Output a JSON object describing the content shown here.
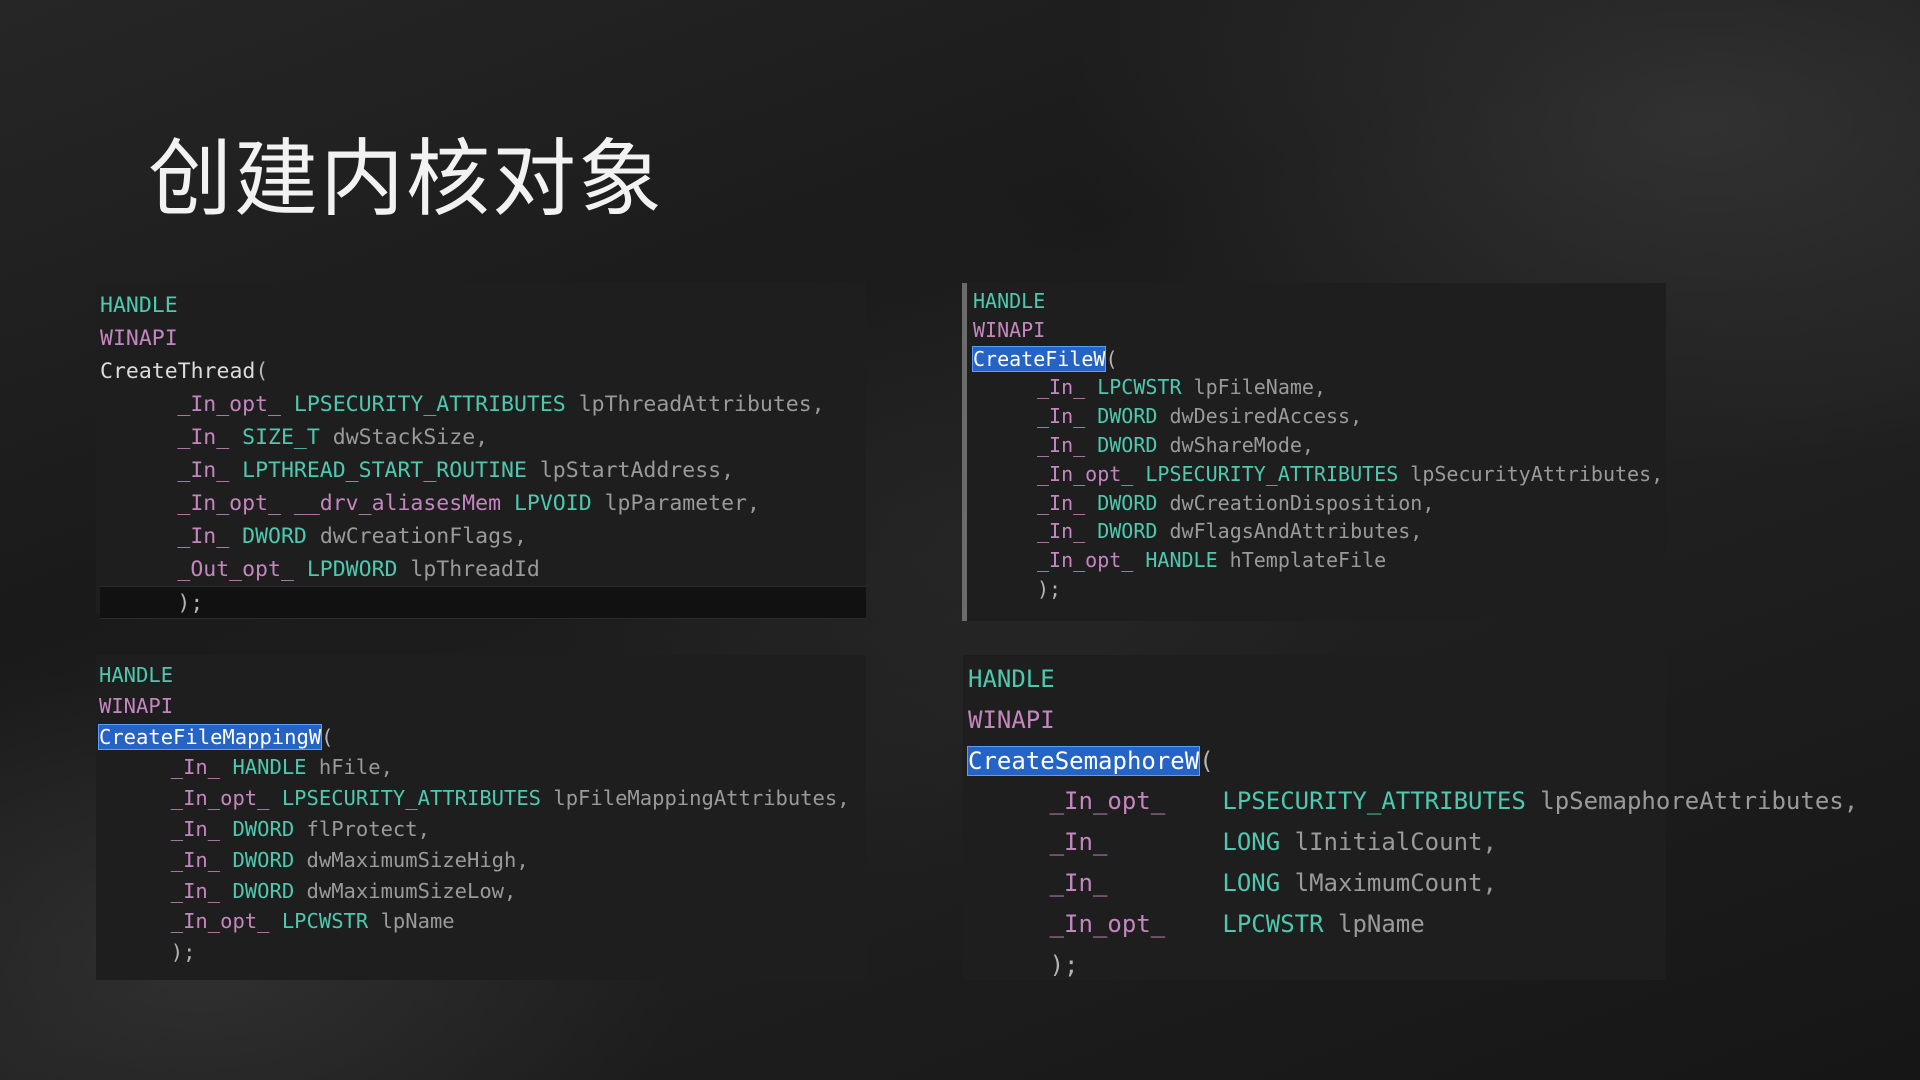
{
  "slide": {
    "title": "创建内核对象"
  },
  "panels": [
    {
      "id": "create-thread",
      "lines": [
        [
          {
            "t": "kw",
            "s": "HANDLE"
          }
        ],
        [
          {
            "t": "call",
            "s": "WINAPI"
          }
        ],
        [
          {
            "t": "func",
            "s": "CreateThread"
          },
          {
            "t": "punc",
            "s": "("
          }
        ],
        [
          {
            "t": "sal",
            "s": "_In_opt_"
          },
          {
            "t": "type",
            "s": "LPSECURITY_ATTRIBUTES"
          },
          {
            "t": "name",
            "s": "lpThreadAttributes,"
          }
        ],
        [
          {
            "t": "sal",
            "s": "_In_"
          },
          {
            "t": "type",
            "s": "SIZE_T"
          },
          {
            "t": "name",
            "s": "dwStackSize,"
          }
        ],
        [
          {
            "t": "sal",
            "s": "_In_"
          },
          {
            "t": "type",
            "s": "LPTHREAD_START_ROUTINE"
          },
          {
            "t": "name",
            "s": "lpStartAddress,"
          }
        ],
        [
          {
            "t": "sal",
            "s": "_In_opt_"
          },
          {
            "t": "sal",
            "s": "__drv_aliasesMem"
          },
          {
            "t": "type",
            "s": "LPVOID"
          },
          {
            "t": "name",
            "s": "lpParameter,"
          }
        ],
        [
          {
            "t": "sal",
            "s": "_In_"
          },
          {
            "t": "type",
            "s": "DWORD"
          },
          {
            "t": "name",
            "s": "dwCreationFlags,"
          }
        ],
        [
          {
            "t": "sal",
            "s": "_Out_opt_"
          },
          {
            "t": "type",
            "s": "LPDWORD"
          },
          {
            "t": "name",
            "s": "lpThreadId"
          }
        ],
        [
          {
            "t": "punc",
            "s": ");"
          }
        ]
      ]
    },
    {
      "id": "create-file",
      "lines": [
        [
          {
            "t": "kw",
            "s": "HANDLE"
          }
        ],
        [
          {
            "t": "call",
            "s": "WINAPI"
          }
        ],
        [
          {
            "t": "sel",
            "s": "CreateFileW"
          },
          {
            "t": "punc",
            "s": "("
          }
        ],
        [
          {
            "t": "sal",
            "s": "_In_"
          },
          {
            "t": "type",
            "s": "LPCWSTR"
          },
          {
            "t": "name",
            "s": "lpFileName,"
          }
        ],
        [
          {
            "t": "sal",
            "s": "_In_"
          },
          {
            "t": "type",
            "s": "DWORD"
          },
          {
            "t": "name",
            "s": "dwDesiredAccess,"
          }
        ],
        [
          {
            "t": "sal",
            "s": "_In_"
          },
          {
            "t": "type",
            "s": "DWORD"
          },
          {
            "t": "name",
            "s": "dwShareMode,"
          }
        ],
        [
          {
            "t": "sal",
            "s": "_In_opt_"
          },
          {
            "t": "type",
            "s": "LPSECURITY_ATTRIBUTES"
          },
          {
            "t": "name",
            "s": "lpSecurityAttributes,"
          }
        ],
        [
          {
            "t": "sal",
            "s": "_In_"
          },
          {
            "t": "type",
            "s": "DWORD"
          },
          {
            "t": "name",
            "s": "dwCreationDisposition,"
          }
        ],
        [
          {
            "t": "sal",
            "s": "_In_"
          },
          {
            "t": "type",
            "s": "DWORD"
          },
          {
            "t": "name",
            "s": "dwFlagsAndAttributes,"
          }
        ],
        [
          {
            "t": "sal",
            "s": "_In_opt_"
          },
          {
            "t": "type",
            "s": "HANDLE"
          },
          {
            "t": "name",
            "s": "hTemplateFile"
          }
        ],
        [
          {
            "t": "punc",
            "s": ");"
          }
        ]
      ]
    },
    {
      "id": "create-file-mapping",
      "lines": [
        [
          {
            "t": "kw",
            "s": "HANDLE"
          }
        ],
        [
          {
            "t": "call",
            "s": "WINAPI"
          }
        ],
        [
          {
            "t": "sel",
            "s": "CreateFileMappingW"
          },
          {
            "t": "punc",
            "s": "("
          }
        ],
        [
          {
            "t": "sal",
            "s": "_In_"
          },
          {
            "t": "type",
            "s": "HANDLE"
          },
          {
            "t": "name",
            "s": "hFile,"
          }
        ],
        [
          {
            "t": "sal",
            "s": "_In_opt_"
          },
          {
            "t": "type",
            "s": "LPSECURITY_ATTRIBUTES"
          },
          {
            "t": "name",
            "s": "lpFileMappingAttributes,"
          }
        ],
        [
          {
            "t": "sal",
            "s": "_In_"
          },
          {
            "t": "type",
            "s": "DWORD"
          },
          {
            "t": "name",
            "s": "flProtect,"
          }
        ],
        [
          {
            "t": "sal",
            "s": "_In_"
          },
          {
            "t": "type",
            "s": "DWORD"
          },
          {
            "t": "name",
            "s": "dwMaximumSizeHigh,"
          }
        ],
        [
          {
            "t": "sal",
            "s": "_In_"
          },
          {
            "t": "type",
            "s": "DWORD"
          },
          {
            "t": "name",
            "s": "dwMaximumSizeLow,"
          }
        ],
        [
          {
            "t": "sal",
            "s": "_In_opt_"
          },
          {
            "t": "type",
            "s": "LPCWSTR"
          },
          {
            "t": "name",
            "s": "lpName"
          }
        ],
        [
          {
            "t": "punc",
            "s": ");"
          }
        ]
      ]
    },
    {
      "id": "create-semaphore",
      "lines": [
        [
          {
            "t": "kw",
            "s": "HANDLE"
          }
        ],
        [
          {
            "t": "call",
            "s": "WINAPI"
          }
        ],
        [
          {
            "t": "sel",
            "s": "CreateSemaphoreW"
          },
          {
            "t": "punc",
            "s": "("
          }
        ],
        [
          {
            "t": "sal",
            "s": "_In_opt_"
          },
          {
            "t": "type",
            "s": "LPSECURITY_ATTRIBUTES"
          },
          {
            "t": "name",
            "s": "lpSemaphoreAttributes,"
          }
        ],
        [
          {
            "t": "sal",
            "s": "_In_"
          },
          {
            "t": "type",
            "s": "LONG"
          },
          {
            "t": "name",
            "s": "lInitialCount,"
          }
        ],
        [
          {
            "t": "sal",
            "s": "_In_"
          },
          {
            "t": "type",
            "s": "LONG"
          },
          {
            "t": "name",
            "s": "lMaximumCount,"
          }
        ],
        [
          {
            "t": "sal",
            "s": "_In_opt_"
          },
          {
            "t": "type",
            "s": "LPCWSTR"
          },
          {
            "t": "name",
            "s": "lpName"
          }
        ],
        [
          {
            "t": "punc",
            "s": ");"
          }
        ]
      ]
    }
  ]
}
